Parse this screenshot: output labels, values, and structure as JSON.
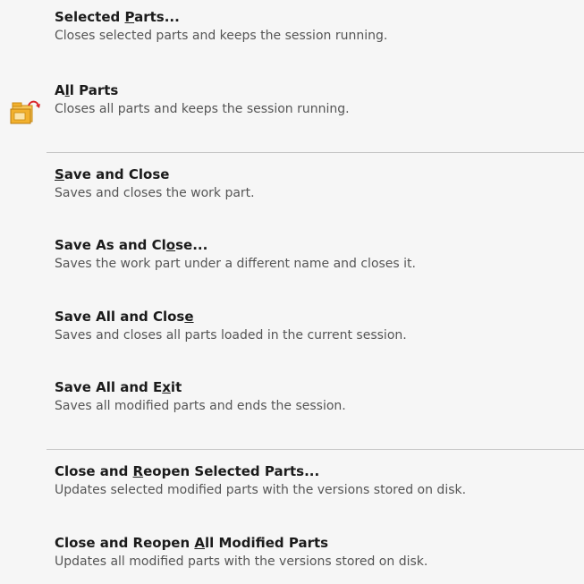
{
  "menu": {
    "items": [
      {
        "pre": "Selected ",
        "ul": "P",
        "post": "arts...",
        "desc": "Closes selected parts and keeps the session running."
      },
      {
        "pre": "A",
        "ul": "l",
        "post": "l Parts",
        "desc": "Closes all parts and keeps the session running.",
        "icon": "folder-close-icon"
      },
      {
        "pre": "",
        "ul": "S",
        "post": "ave and Close",
        "desc": "Saves and closes the work part."
      },
      {
        "pre": "Save As and Cl",
        "ul": "o",
        "post": "se...",
        "desc": "Saves the work part under a different name and closes it."
      },
      {
        "pre": "Save All and Clos",
        "ul": "e",
        "post": "",
        "desc": "Saves and closes all parts loaded in the current session."
      },
      {
        "pre": "Save All and E",
        "ul": "x",
        "post": "it",
        "desc": "Saves all modified parts and ends the session."
      },
      {
        "pre": "Close and ",
        "ul": "R",
        "post": "eopen Selected Parts...",
        "desc": "Updates selected modified parts with the versions stored on disk."
      },
      {
        "pre": "Close and Reopen ",
        "ul": "A",
        "post": "ll Modified Parts",
        "desc": "Updates all modified parts with the versions stored on disk."
      }
    ]
  },
  "colors": {
    "background": "#f6f6f6",
    "title": "#1b1b1b",
    "description": "#555555",
    "separator": "#c6c6c6",
    "icon_folder": "#f2b12e",
    "icon_arrow": "#d9262b"
  }
}
